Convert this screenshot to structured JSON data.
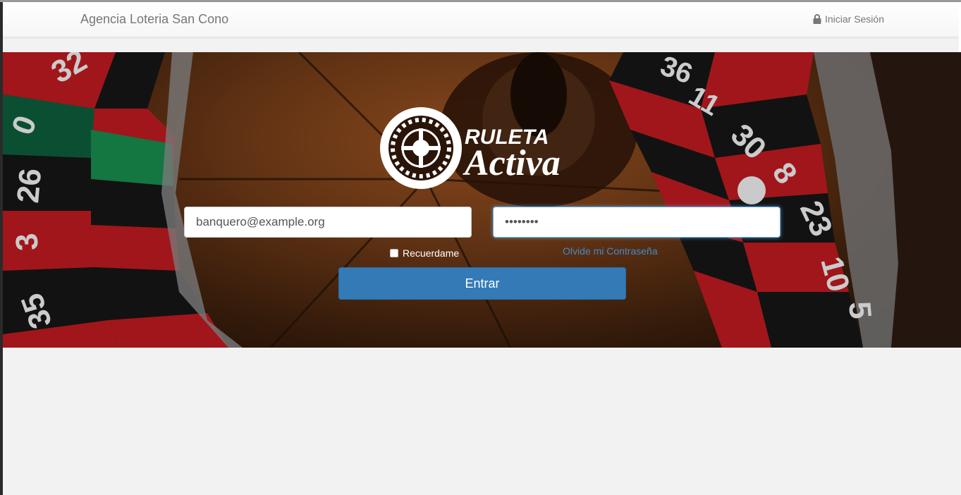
{
  "navbar": {
    "brand": "Agencia Loteria San Cono",
    "login_label": "Iniciar Sesión"
  },
  "logo": {
    "line1": "RULETA",
    "line2": "Activa"
  },
  "form": {
    "email_value": "banquero@example.org",
    "password_value": "••••••••",
    "remember_label": "Recuerdame",
    "remember_checked": false,
    "forgot_label": "Olvide mi Contraseña",
    "submit_label": "Entrar"
  },
  "wheel_numbers_left": [
    "32",
    "0",
    "26",
    "3",
    "35"
  ],
  "wheel_numbers_right": [
    "36",
    "11",
    "30",
    "8",
    "23",
    "10",
    "5"
  ],
  "icons": [
    "lock-icon",
    "roulette-wheel-icon"
  ],
  "colors": {
    "accent": "#337ab7",
    "link": "#428bca",
    "wheel_red": "#c0181c",
    "wheel_green": "#0f8a3c"
  }
}
